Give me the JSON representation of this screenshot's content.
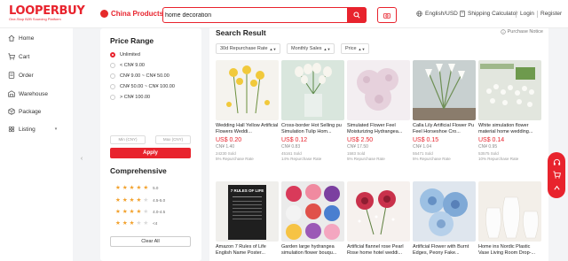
{
  "logo": {
    "brand": "LOOPERBUY",
    "tagline": "One-Stop B2B Sourcing Platform"
  },
  "header": {
    "category_label": "China Products",
    "search_value": "home decoration",
    "language": "English/USD",
    "shipping": "Shipping Calculator",
    "login": "Login",
    "register": "Register"
  },
  "sidebar": {
    "items": [
      {
        "label": "Home",
        "icon": "home-icon"
      },
      {
        "label": "Cart",
        "icon": "cart-icon"
      },
      {
        "label": "Order",
        "icon": "order-icon"
      },
      {
        "label": "Warehouse",
        "icon": "warehouse-icon"
      },
      {
        "label": "Package",
        "icon": "package-icon"
      },
      {
        "label": "Listing",
        "icon": "listing-icon"
      }
    ]
  },
  "filter": {
    "price_title": "Price Range",
    "price_options": [
      "Unlimited",
      "< CN¥ 9.00",
      "CN¥ 9.00 ~ CN¥ 50.00",
      "CN¥ 50.00 ~ CN¥ 100.00",
      "> CN¥ 100.00"
    ],
    "selected_index": 0,
    "min_placeholder": "Min (CNY)",
    "max_placeholder": "Max (CNY)",
    "apply": "Apply",
    "comp_title": "Comprehensive",
    "ratings": [
      {
        "stars": 5,
        "label": "5.0"
      },
      {
        "stars": 4,
        "label": "4.5-5.0"
      },
      {
        "stars": 4,
        "label": "4.0-4.5"
      },
      {
        "stars": 3,
        "label": "<4"
      }
    ],
    "clear": "Clear All"
  },
  "results": {
    "title": "Search Result",
    "notice": "Purchase Notice",
    "sorts": [
      "30d Repurchase Rate",
      "Monthly Sales",
      "Price"
    ],
    "products": [
      {
        "title": "Wedding Hall Yellow Artificial Flowers Weddi...",
        "usd": "US$ 0.20",
        "cny": "CN¥ 1.40",
        "sold": "24230 Sold",
        "rep": "5% Repurchase Rate",
        "bg": "#f5f3ee",
        "accent": "#f1c93b"
      },
      {
        "title": "Cross-border Hot Selling pu Simulation Tulip Hom...",
        "usd": "US$ 0.12",
        "cny": "CN¥ 0.83",
        "sold": "45161 Sold",
        "rep": "14% Repurchase Rate",
        "bg": "#d9e6dd",
        "accent": "#f0eee6"
      },
      {
        "title": "Simulated Flower Feel Moisturizing Hydrangea...",
        "usd": "US$ 2.50",
        "cny": "CN¥ 17.50",
        "sold": "1583 Sold",
        "rep": "5% Repurchase Rate",
        "bg": "#efe8ec",
        "accent": "#e7d3dd"
      },
      {
        "title": "Calla Lily Artificial Flower Pu Feel Horseshoe Cro...",
        "usd": "US$ 0.15",
        "cny": "CN¥ 1.04",
        "sold": "55471 Sold",
        "rep": "5% Repurchase Rate",
        "bg": "#cfd6d6",
        "accent": "#f7f7f4"
      },
      {
        "title": "White simulation flower material home wedding...",
        "usd": "US$ 0.14",
        "cny": "CN¥ 0.95",
        "sold": "53575 Sold",
        "rep": "10% Repurchase Rate",
        "bg": "#e4e7e1",
        "accent": "#7a9f5a"
      },
      {
        "title": "Amazon 7 Rules of Life English Name Poster...",
        "usd": "",
        "cny": "",
        "sold": "",
        "rep": "",
        "bg": "#2a2a2a",
        "accent": "#ffffff"
      },
      {
        "title": "Garden large hydrangea simulation flower bouqu...",
        "usd": "",
        "cny": "",
        "sold": "",
        "rep": "",
        "bg": "#ececec",
        "accent": "#d93a5a"
      },
      {
        "title": "Artificial flannel rose Pearl Rose home hotel weddi...",
        "usd": "",
        "cny": "",
        "sold": "",
        "rep": "",
        "bg": "#f6f1ee",
        "accent": "#c9314b"
      },
      {
        "title": "Artificial Flower with Burnt Edges, Peony Fake...",
        "usd": "",
        "cny": "",
        "sold": "",
        "rep": "",
        "bg": "#dfe6ee",
        "accent": "#7fa9d6"
      },
      {
        "title": "Home ins Nordic Plastic Vase Living Room Drop-...",
        "usd": "",
        "cny": "",
        "sold": "",
        "rep": "",
        "bg": "#f3efe9",
        "accent": "#ffffff"
      }
    ],
    "poster_text": [
      "7 RULES OF LIFE"
    ]
  }
}
